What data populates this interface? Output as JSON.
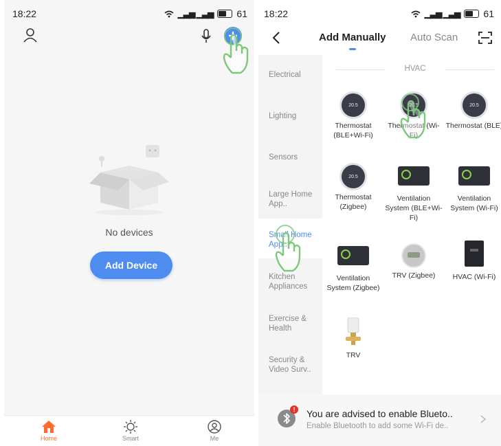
{
  "colors": {
    "accent": "#4f8cf0",
    "home_active": "#ff6b2d",
    "gesture_green": "#7dc87a"
  },
  "left_screen": {
    "status_bar": {
      "time": "18:22",
      "battery": "61",
      "wifi_icon": "wifi-icon",
      "signal_icon": "signal-icon"
    },
    "header": {
      "profile_icon": "person-icon",
      "mic_icon": "microphone-icon",
      "add_icon": "plus-circle-icon"
    },
    "empty_state": {
      "illustration": "empty-box-icon",
      "message": "No devices",
      "button_label": "Add Device"
    },
    "tabbar": [
      {
        "label": "Home",
        "icon": "home-icon",
        "active": true
      },
      {
        "label": "Smart",
        "icon": "sun-icon",
        "active": false
      },
      {
        "label": "Me",
        "icon": "profile-circle-icon",
        "active": false
      }
    ]
  },
  "right_screen": {
    "status_bar": {
      "time": "18:22",
      "battery": "61"
    },
    "nav": {
      "back_icon": "chevron-left-icon",
      "tab_add_manually": "Add Manually",
      "tab_auto_scan": "Auto Scan",
      "scan_icon": "scan-frame-icon"
    },
    "sidebar": [
      {
        "label": "Electrical",
        "active": false
      },
      {
        "label": "Lighting",
        "active": false
      },
      {
        "label": "Sensors",
        "active": false
      },
      {
        "label": "Large Home App..",
        "active": false
      },
      {
        "label": "Small Home App..",
        "active": true
      },
      {
        "label": "Kitchen Appliances",
        "active": false
      },
      {
        "label": "Exercise & Health",
        "active": false
      },
      {
        "label": "Security & Video Surv..",
        "active": false
      }
    ],
    "section_title": "HVAC",
    "devices": [
      {
        "name": "Thermostat (BLE+Wi-Fi)",
        "icon": "thermostat",
        "reading": "20.5"
      },
      {
        "name": "Thermostat (Wi-Fi)",
        "icon": "thermostat",
        "reading": "20.5"
      },
      {
        "name": "Thermostat (BLE)",
        "icon": "thermostat",
        "reading": "20.5"
      },
      {
        "name": "Thermostat (Zigbee)",
        "icon": "thermostat",
        "reading": "20.5"
      },
      {
        "name": "Ventilation System (BLE+Wi-Fi)",
        "icon": "ventilation"
      },
      {
        "name": "Ventilation System (Wi-Fi)",
        "icon": "ventilation"
      },
      {
        "name": "Ventilation System (Zigbee)",
        "icon": "ventilation"
      },
      {
        "name": "TRV (Zigbee)",
        "icon": "trv-round"
      },
      {
        "name": "HVAC (Wi-Fi)",
        "icon": "hvac-panel"
      },
      {
        "name": "TRV",
        "icon": "trv-valve"
      }
    ],
    "banner": {
      "icon": "bluetooth-icon",
      "badge": "!",
      "title": "You are advised to enable Blueto..",
      "subtitle": "Enable Bluetooth to add some Wi-Fi de..",
      "chevron_icon": "chevron-right-icon"
    }
  }
}
